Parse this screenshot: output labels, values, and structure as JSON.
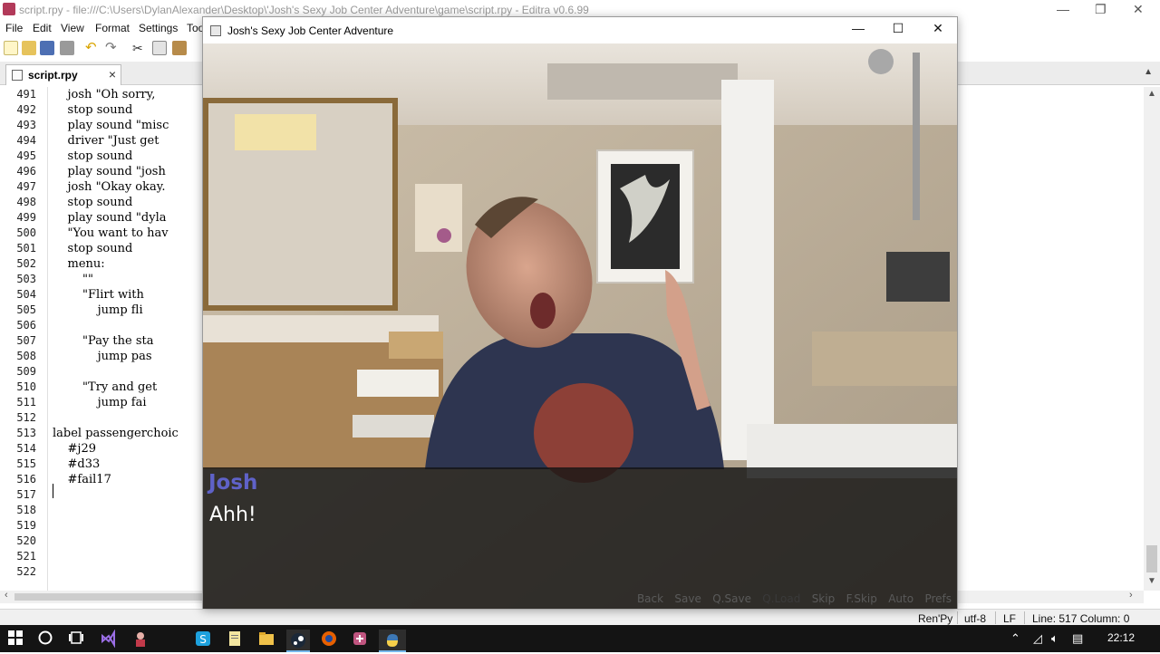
{
  "editra": {
    "title": "script.rpy - file:///C:\\Users\\DylanAlexander\\Desktop\\'Josh's Sexy Job Center Adventure\\game\\script.rpy - Editra v0.6.99",
    "menu": [
      "File",
      "Edit",
      "View",
      "Format",
      "Settings",
      "Too"
    ],
    "tab": {
      "label": "script.rpy"
    },
    "lines": [
      {
        "n": "491",
        "text": "    josh \"Oh sorry,"
      },
      {
        "n": "492",
        "text": "    stop sound"
      },
      {
        "n": "493",
        "text": "    play sound \"misc"
      },
      {
        "n": "494",
        "text": "    driver \"Just get"
      },
      {
        "n": "495",
        "text": "    stop sound"
      },
      {
        "n": "496",
        "text": "    play sound \"josh"
      },
      {
        "n": "497",
        "text": "    josh \"Okay okay."
      },
      {
        "n": "498",
        "text": "    stop sound"
      },
      {
        "n": "499",
        "text": "    play sound \"dyla"
      },
      {
        "n": "500",
        "text": "    \"You want to hav"
      },
      {
        "n": "501",
        "text": "    stop sound"
      },
      {
        "n": "502",
        "text": "    menu:"
      },
      {
        "n": "503",
        "text": "        \"\""
      },
      {
        "n": "504",
        "text": "        \"Flirt with"
      },
      {
        "n": "505",
        "text": "            jump fli"
      },
      {
        "n": "506",
        "text": ""
      },
      {
        "n": "507",
        "text": "        \"Pay the sta"
      },
      {
        "n": "508",
        "text": "            jump pas"
      },
      {
        "n": "509",
        "text": ""
      },
      {
        "n": "510",
        "text": "        \"Try and get"
      },
      {
        "n": "511",
        "text": "            jump fai"
      },
      {
        "n": "512",
        "text": ""
      },
      {
        "n": "513",
        "text": "label passengerchoic"
      },
      {
        "n": "514",
        "text": "    #j29"
      },
      {
        "n": "515",
        "text": "    #d33"
      },
      {
        "n": "516",
        "text": "    #fail17"
      },
      {
        "n": "517",
        "text": ""
      },
      {
        "n": "518",
        "text": ""
      },
      {
        "n": "519",
        "text": ""
      },
      {
        "n": "520",
        "text": ""
      },
      {
        "n": "521",
        "text": ""
      },
      {
        "n": "522",
        "text": ""
      }
    ],
    "status": {
      "lexer": "Ren'Py",
      "encoding": "utf-8",
      "eol": "LF",
      "position": "Line: 517  Column: 0"
    }
  },
  "game": {
    "title": "Josh's Sexy Job Center Adventure",
    "speaker": "Josh",
    "dialogue": "Ahh!",
    "quick_menu": [
      "Back",
      "Save",
      "Q.Save",
      "Q.Load",
      "Skip",
      "F.Skip",
      "Auto",
      "Prefs"
    ],
    "colors": {
      "speaker": "#5f62c8",
      "dialogue": "#ffffff"
    }
  },
  "taskbar": {
    "clock": "22:12"
  }
}
